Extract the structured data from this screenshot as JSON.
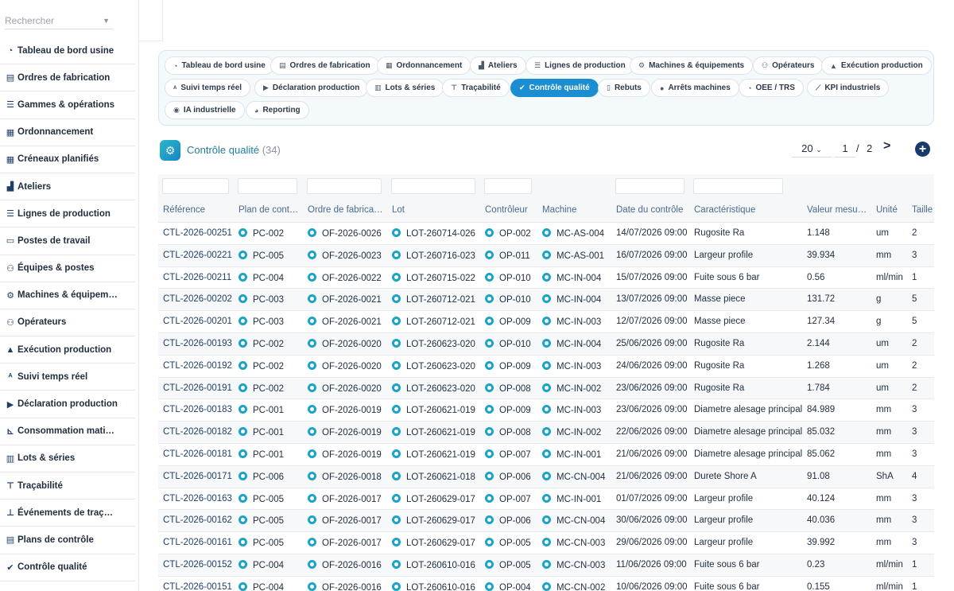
{
  "sidebar": {
    "search_placeholder": "Rechercher",
    "items": [
      {
        "label": "Tableau de bord usine",
        "icon": "gauge-icon",
        "glyph": "◔"
      },
      {
        "label": "Ordres de fabrication",
        "icon": "clipboard-icon",
        "glyph": "▤"
      },
      {
        "label": "Gammes & opérations",
        "icon": "list-icon",
        "glyph": "☰"
      },
      {
        "label": "Ordonnancement",
        "icon": "calendar-icon",
        "glyph": "▦"
      },
      {
        "label": "Créneaux planifiés",
        "icon": "calendar-check-icon",
        "glyph": "▦"
      },
      {
        "label": "Ateliers",
        "icon": "factory-icon",
        "glyph": "▟"
      },
      {
        "label": "Lignes de production",
        "icon": "lines-icon",
        "glyph": "☰"
      },
      {
        "label": "Postes de travail",
        "icon": "desktop-icon",
        "glyph": "▭"
      },
      {
        "label": "Équipes & postes",
        "icon": "users-icon",
        "glyph": "⚇"
      },
      {
        "label": "Machines & équipem…",
        "icon": "gears-icon",
        "glyph": "⚙"
      },
      {
        "label": "Opérateurs",
        "icon": "people-icon",
        "glyph": "⚇"
      },
      {
        "label": "Exécution production",
        "icon": "conveyor-icon",
        "glyph": "▲"
      },
      {
        "label": "Suivi temps réel",
        "icon": "broadcast-icon",
        "glyph": "ᴬ"
      },
      {
        "label": "Déclaration production",
        "icon": "play-circle-icon",
        "glyph": "▶"
      },
      {
        "label": "Consommation mati…",
        "icon": "dolly-icon",
        "glyph": "⊾"
      },
      {
        "label": "Lots & séries",
        "icon": "barcode-icon",
        "glyph": "▥"
      },
      {
        "label": "Traçabilité",
        "icon": "sitemap-icon",
        "glyph": "⊤"
      },
      {
        "label": "Événements de traç…",
        "icon": "network-icon",
        "glyph": "⊥"
      },
      {
        "label": "Plans de contrôle",
        "icon": "clipboard-check-icon",
        "glyph": "▤"
      },
      {
        "label": "Contrôle qualité",
        "icon": "check-double-icon",
        "glyph": "✔"
      }
    ]
  },
  "tabs": [
    {
      "label": "Tableau de bord usine",
      "icon": "gauge-icon",
      "glyph": "◔",
      "active": false
    },
    {
      "label": "Ordres de fabrication",
      "icon": "clipboard-icon",
      "glyph": "▤",
      "active": false
    },
    {
      "label": "Ordonnancement",
      "icon": "calendar-icon",
      "glyph": "▦",
      "active": false
    },
    {
      "label": "Ateliers",
      "icon": "factory-icon",
      "glyph": "▟",
      "active": false
    },
    {
      "label": "Lignes de production",
      "icon": "lines-icon",
      "glyph": "☰",
      "active": false
    },
    {
      "label": "Machines & équipements",
      "icon": "gears-icon",
      "glyph": "⚙",
      "active": false
    },
    {
      "label": "Opérateurs",
      "icon": "people-icon",
      "glyph": "⚇",
      "active": false
    },
    {
      "label": "Exécution production",
      "icon": "conveyor-icon",
      "glyph": "▲",
      "active": false
    },
    {
      "label": "Suivi temps réel",
      "icon": "broadcast-icon",
      "glyph": "ᴬ",
      "active": false
    },
    {
      "label": "Déclaration production",
      "icon": "play-circle-icon",
      "glyph": "▶",
      "active": false
    },
    {
      "label": "Lots & séries",
      "icon": "barcode-icon",
      "glyph": "▥",
      "active": false
    },
    {
      "label": "Traçabilité",
      "icon": "sitemap-icon",
      "glyph": "⊤",
      "active": false
    },
    {
      "label": "Contrôle qualité",
      "icon": "check-double-icon",
      "glyph": "✔",
      "active": true
    },
    {
      "label": "Rebuts",
      "icon": "trash-icon",
      "glyph": "▯",
      "active": false
    },
    {
      "label": "Arrêts machines",
      "icon": "stop-circle-icon",
      "glyph": "●",
      "active": false
    },
    {
      "label": "OEE / TRS",
      "icon": "speedometer-icon",
      "glyph": "◔",
      "active": false
    },
    {
      "label": "KPI industriels",
      "icon": "chart-line-icon",
      "glyph": "⟋",
      "active": false
    },
    {
      "label": "IA industrielle",
      "icon": "brain-icon",
      "glyph": "◉",
      "active": false
    },
    {
      "label": "Reporting",
      "icon": "pie-chart-icon",
      "glyph": "◕",
      "active": false
    }
  ],
  "page": {
    "title": "Contrôle qualité",
    "count": "(34)",
    "page_size": "20",
    "page_size_chevron": "⌄",
    "current_page": "1",
    "separator": "/",
    "total_pages": "2",
    "next_glyph": ">",
    "add_glyph": "+"
  },
  "table": {
    "columns": [
      "Référence",
      "Plan de cont…",
      "Ordre de fabrica…",
      "Lot",
      "Contrôleur",
      "Machine",
      "Date du contrôle",
      "Caractéristique",
      "Valeur mesu…",
      "Unité",
      "Taille"
    ],
    "rows": [
      [
        "CTL-2026-00251",
        "PC-002",
        "OF-2026-0026",
        "LOT-260714-026",
        "OP-002",
        "MC-AS-004",
        "14/07/2026 09:00",
        "Rugosite Ra",
        "1.148",
        "um",
        "2"
      ],
      [
        "CTL-2026-00221",
        "PC-005",
        "OF-2026-0023",
        "LOT-260716-023",
        "OP-011",
        "MC-AS-001",
        "16/07/2026 09:00",
        "Largeur profile",
        "39.934",
        "mm",
        "3"
      ],
      [
        "CTL-2026-00211",
        "PC-004",
        "OF-2026-0022",
        "LOT-260715-022",
        "OP-010",
        "MC-IN-004",
        "15/07/2026 09:00",
        "Fuite sous 6 bar",
        "0.56",
        "ml/min",
        "1"
      ],
      [
        "CTL-2026-00202",
        "PC-003",
        "OF-2026-0021",
        "LOT-260712-021",
        "OP-010",
        "MC-IN-004",
        "13/07/2026 09:00",
        "Masse piece",
        "131.72",
        "g",
        "5"
      ],
      [
        "CTL-2026-00201",
        "PC-003",
        "OF-2026-0021",
        "LOT-260712-021",
        "OP-009",
        "MC-IN-003",
        "12/07/2026 09:00",
        "Masse piece",
        "127.34",
        "g",
        "5"
      ],
      [
        "CTL-2026-00193",
        "PC-002",
        "OF-2026-0020",
        "LOT-260623-020",
        "OP-010",
        "MC-IN-004",
        "25/06/2026 09:00",
        "Rugosite Ra",
        "2.144",
        "um",
        "2"
      ],
      [
        "CTL-2026-00192",
        "PC-002",
        "OF-2026-0020",
        "LOT-260623-020",
        "OP-009",
        "MC-IN-003",
        "24/06/2026 09:00",
        "Rugosite Ra",
        "1.268",
        "um",
        "2"
      ],
      [
        "CTL-2026-00191",
        "PC-002",
        "OF-2026-0020",
        "LOT-260623-020",
        "OP-008",
        "MC-IN-002",
        "23/06/2026 09:00",
        "Rugosite Ra",
        "1.784",
        "um",
        "2"
      ],
      [
        "CTL-2026-00183",
        "PC-001",
        "OF-2026-0019",
        "LOT-260621-019",
        "OP-009",
        "MC-IN-003",
        "23/06/2026 09:00",
        "Diametre alesage principal",
        "84.989",
        "mm",
        "3"
      ],
      [
        "CTL-2026-00182",
        "PC-001",
        "OF-2026-0019",
        "LOT-260621-019",
        "OP-008",
        "MC-IN-002",
        "22/06/2026 09:00",
        "Diametre alesage principal",
        "85.032",
        "mm",
        "3"
      ],
      [
        "CTL-2026-00181",
        "PC-001",
        "OF-2026-0019",
        "LOT-260621-019",
        "OP-007",
        "MC-IN-001",
        "21/06/2026 09:00",
        "Diametre alesage principal",
        "85.062",
        "mm",
        "3"
      ],
      [
        "CTL-2026-00171",
        "PC-006",
        "OF-2026-0018",
        "LOT-260621-018",
        "OP-006",
        "MC-CN-004",
        "21/06/2026 09:00",
        "Durete Shore A",
        "91.08",
        "ShA",
        "4"
      ],
      [
        "CTL-2026-00163",
        "PC-005",
        "OF-2026-0017",
        "LOT-260629-017",
        "OP-007",
        "MC-IN-001",
        "01/07/2026 09:00",
        "Largeur profile",
        "40.124",
        "mm",
        "3"
      ],
      [
        "CTL-2026-00162",
        "PC-005",
        "OF-2026-0017",
        "LOT-260629-017",
        "OP-006",
        "MC-CN-004",
        "30/06/2026 09:00",
        "Largeur profile",
        "40.036",
        "mm",
        "3"
      ],
      [
        "CTL-2026-00161",
        "PC-005",
        "OF-2026-0017",
        "LOT-260629-017",
        "OP-005",
        "MC-CN-003",
        "29/06/2026 09:00",
        "Largeur profile",
        "39.992",
        "mm",
        "3"
      ],
      [
        "CTL-2026-00152",
        "PC-004",
        "OF-2026-0016",
        "LOT-260610-016",
        "OP-005",
        "MC-CN-003",
        "11/06/2026 09:00",
        "Fuite sous 6 bar",
        "0.23",
        "ml/min",
        "1"
      ],
      [
        "CTL-2026-00151",
        "PC-004",
        "OF-2026-0016",
        "LOT-260610-016",
        "OP-004",
        "MC-CN-002",
        "10/06/2026 09:00",
        "Fuite sous 6 bar",
        "0.155",
        "ml/min",
        "1"
      ]
    ]
  },
  "colors": {
    "accent": "#1a8ed0",
    "link": "#1f3f66",
    "title": "#1d7fa0",
    "link_icon": "#1da3c6"
  }
}
